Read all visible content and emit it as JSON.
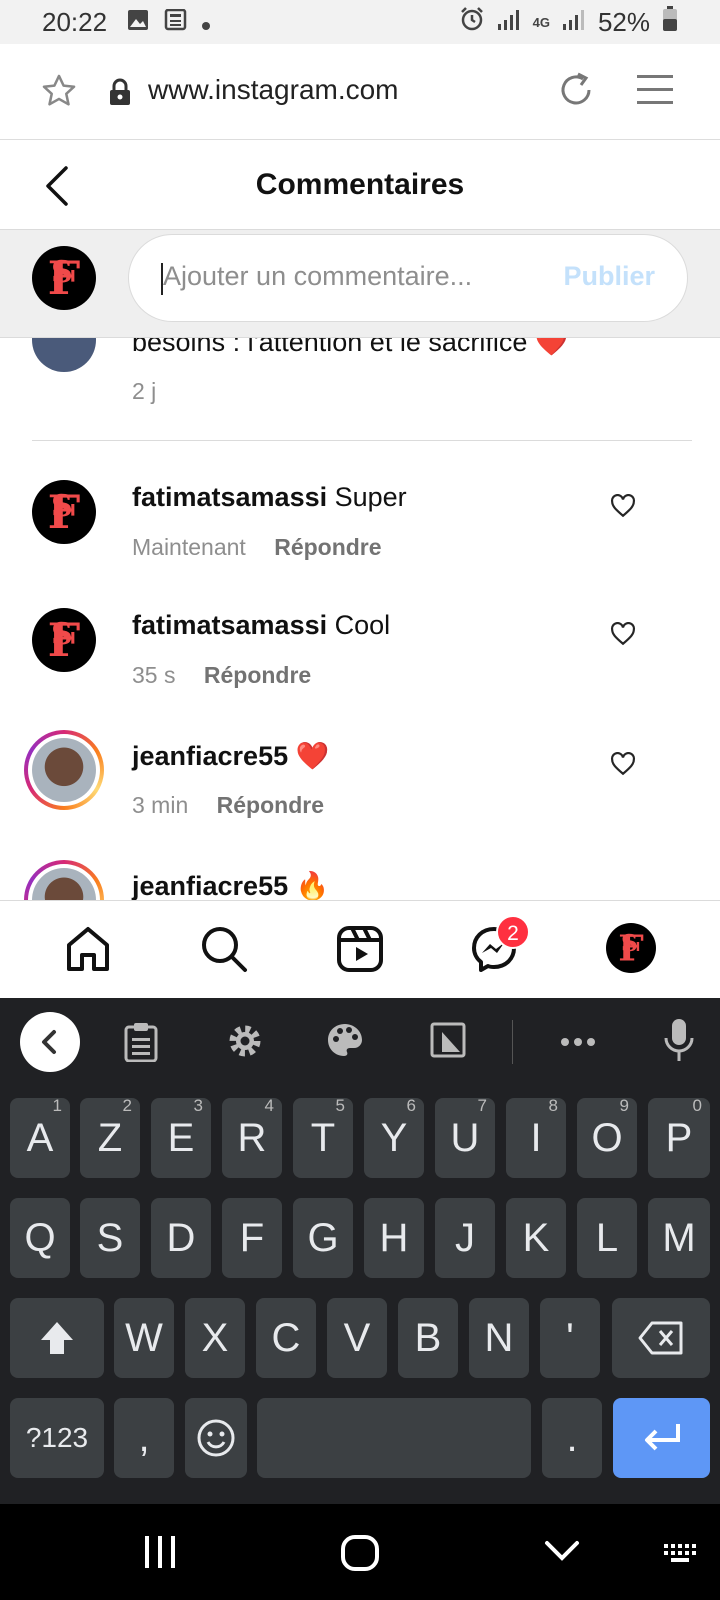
{
  "status_bar": {
    "time": "20:22",
    "network": "4G",
    "battery": "52%"
  },
  "browser": {
    "url": "www.instagram.com"
  },
  "header": {
    "title": "Commentaires"
  },
  "comment_input": {
    "placeholder": "Ajouter un commentaire...",
    "publish_label": "Publier"
  },
  "partial_comment": {
    "text": "besoins : l'attention et le sacrifice",
    "emoji": "❤️",
    "time": "2 j"
  },
  "comments": [
    {
      "username": "fatimatsamassi",
      "text": "Super",
      "time": "Maintenant",
      "reply_label": "Répondre"
    },
    {
      "username": "fatimatsamassi",
      "text": "Cool",
      "time": "35 s",
      "reply_label": "Répondre"
    },
    {
      "username": "jeanfiacre55",
      "text": "❤️",
      "time": "3 min",
      "reply_label": "Répondre"
    },
    {
      "username": "jeanfiacre55",
      "text": "🔥"
    }
  ],
  "bottom_nav": {
    "messages_badge": "2"
  },
  "keyboard": {
    "row1": [
      {
        "k": "A",
        "h": "1"
      },
      {
        "k": "Z",
        "h": "2"
      },
      {
        "k": "E",
        "h": "3"
      },
      {
        "k": "R",
        "h": "4"
      },
      {
        "k": "T",
        "h": "5"
      },
      {
        "k": "Y",
        "h": "6"
      },
      {
        "k": "U",
        "h": "7"
      },
      {
        "k": "I",
        "h": "8"
      },
      {
        "k": "O",
        "h": "9"
      },
      {
        "k": "P",
        "h": "0"
      }
    ],
    "row2": [
      "Q",
      "S",
      "D",
      "F",
      "G",
      "H",
      "J",
      "K",
      "L",
      "M"
    ],
    "row3": [
      "W",
      "X",
      "C",
      "V",
      "B",
      "N",
      "'"
    ],
    "symbols_label": "?123",
    "comma": ",",
    "period": "."
  },
  "colors": {
    "accent_blue": "#0095f6",
    "publish_disabled": "#c4e1fb",
    "badge_red": "#ff3040",
    "keyboard_bg": "#202124",
    "key_bg": "#3c4043",
    "enter_key": "#5e97f6"
  }
}
